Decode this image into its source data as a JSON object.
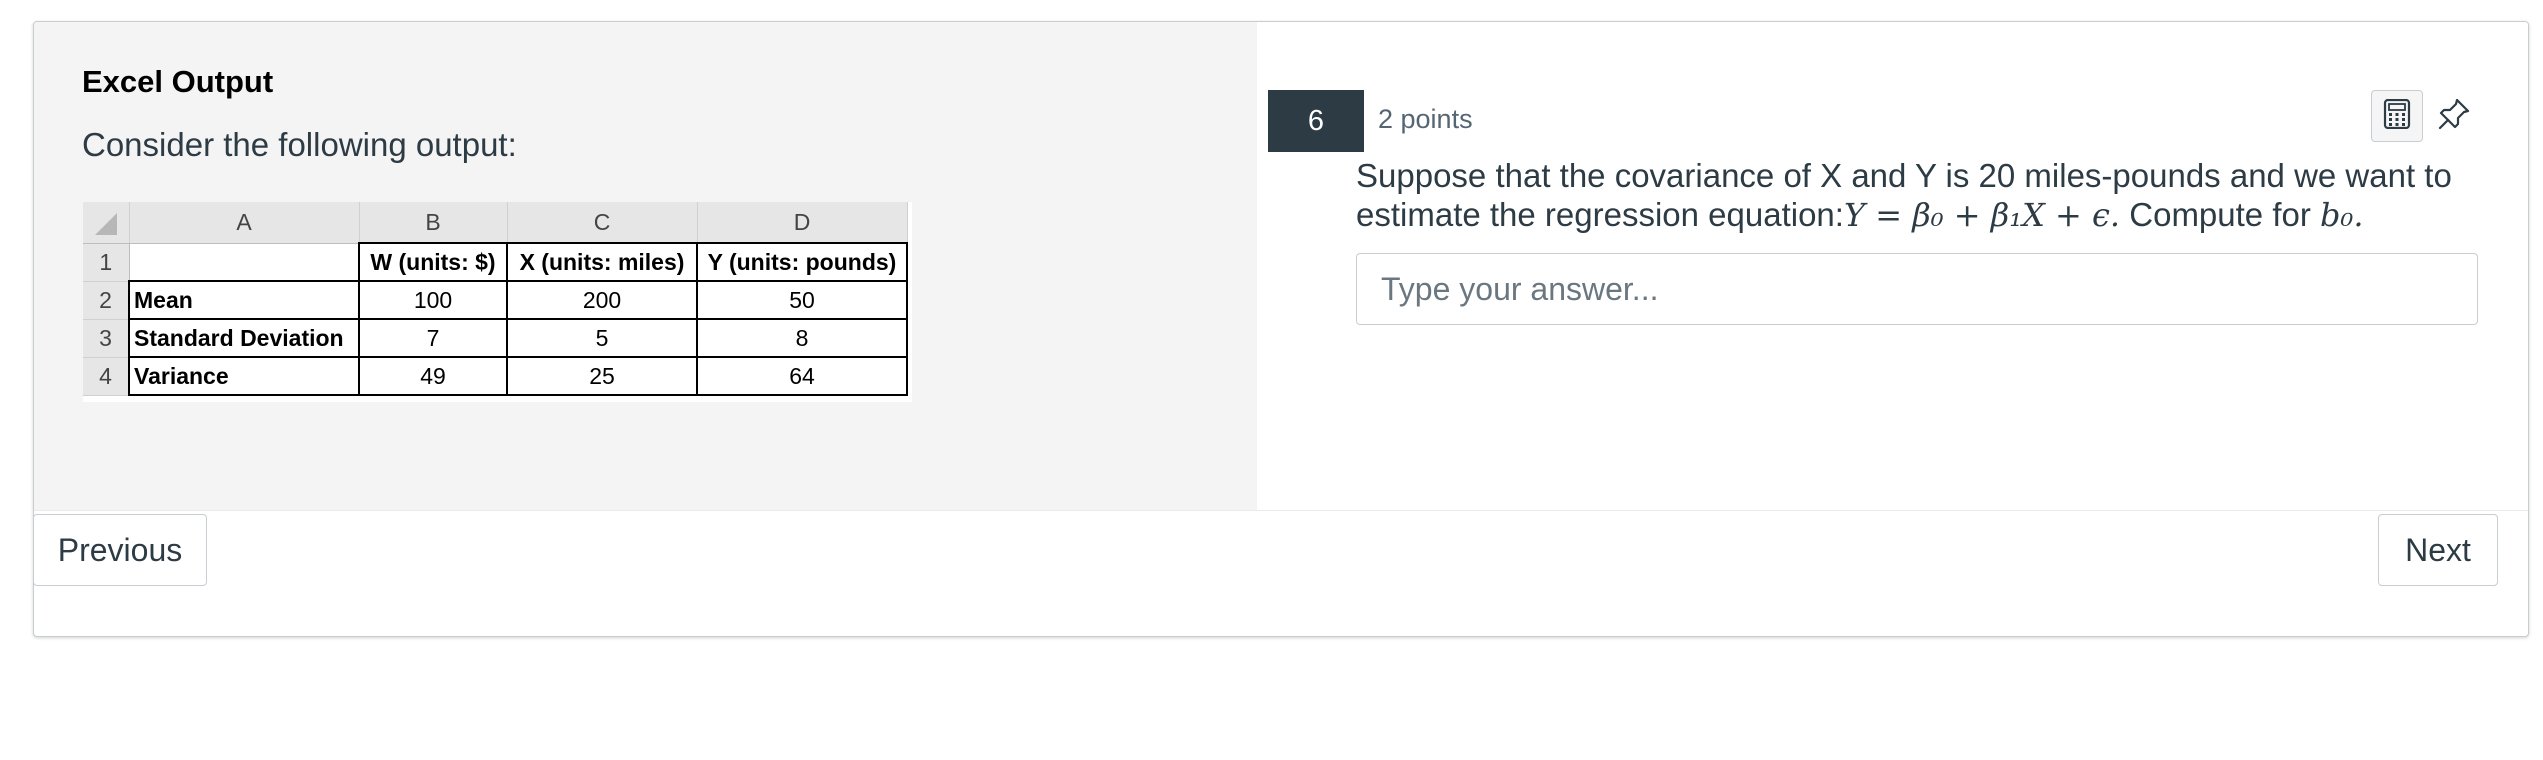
{
  "stimulus": {
    "title": "Excel Output",
    "intro": "Consider the following output:",
    "spreadsheet": {
      "column_headers": [
        "A",
        "B",
        "C",
        "D"
      ],
      "row_numbers": [
        "1",
        "2",
        "3",
        "4"
      ],
      "header_row": [
        "",
        "W (units: $)",
        "X (units: miles)",
        "Y (units: pounds)"
      ],
      "rows": [
        [
          "Mean",
          "100",
          "200",
          "50"
        ],
        [
          "Standard Deviation",
          "7",
          "5",
          "8"
        ],
        [
          "Variance",
          "49",
          "25",
          "64"
        ]
      ]
    }
  },
  "question": {
    "number": "6",
    "points": "2 points",
    "text_prefix": "Suppose that the covariance of X and Y is 20 miles-pounds and we want to estimate the regression equation:",
    "equation": "Y = β₀ + β₁X + ϵ.",
    "text_middle": " Compute for ",
    "target": "b₀.",
    "answer_placeholder": "Type your answer...",
    "answer_value": ""
  },
  "icons": {
    "calculator": "calculator-icon",
    "pin": "pin-icon"
  },
  "navigation": {
    "previous_label": "Previous",
    "next_label": "Next"
  },
  "colors": {
    "accent": "#2d3b45",
    "stimulus_bg": "#f4f4f4",
    "border": "#c7cdd1"
  }
}
